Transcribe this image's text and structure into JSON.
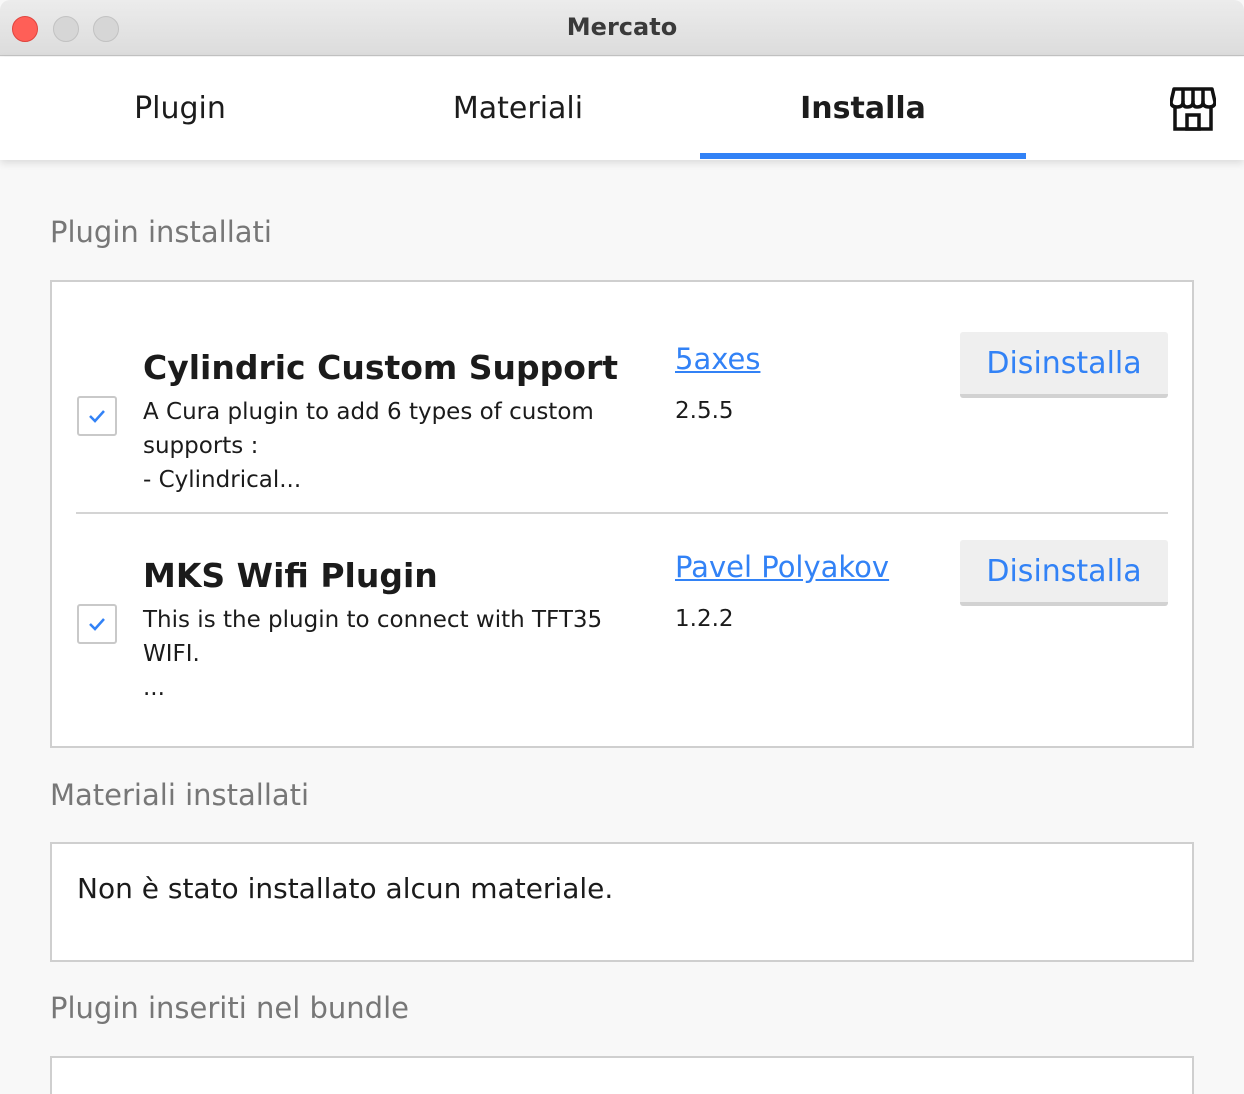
{
  "window": {
    "title": "Mercato"
  },
  "tabs": [
    {
      "label": "Plugin",
      "active": false
    },
    {
      "label": "Materiali",
      "active": false
    },
    {
      "label": "Installa",
      "active": true
    }
  ],
  "accent_color": "#3282f6",
  "icons": {
    "store": "store-icon",
    "check": "check-icon"
  },
  "sections": {
    "installed_plugins": {
      "title": "Plugin installati",
      "items": [
        {
          "name": "Cylindric Custom Support",
          "description_lines": [
            "A Cura plugin  to add 6 types of custom",
            "supports :",
            "- Cylindrical..."
          ],
          "author": "5axes",
          "version": "2.5.5",
          "enabled": true,
          "button": "Disinstalla"
        },
        {
          "name": "MKS Wifi Plugin",
          "description_lines": [
            "This is the plugin to connect with TFT35",
            "WIFI.",
            "..."
          ],
          "author": "Pavel Polyakov",
          "version": "1.2.2",
          "enabled": true,
          "button": "Disinstalla"
        }
      ]
    },
    "installed_materials": {
      "title": "Materiali installati",
      "empty_message": "Non è stato installato alcun materiale."
    },
    "bundled_plugins": {
      "title": "Plugin inseriti nel bundle"
    }
  }
}
